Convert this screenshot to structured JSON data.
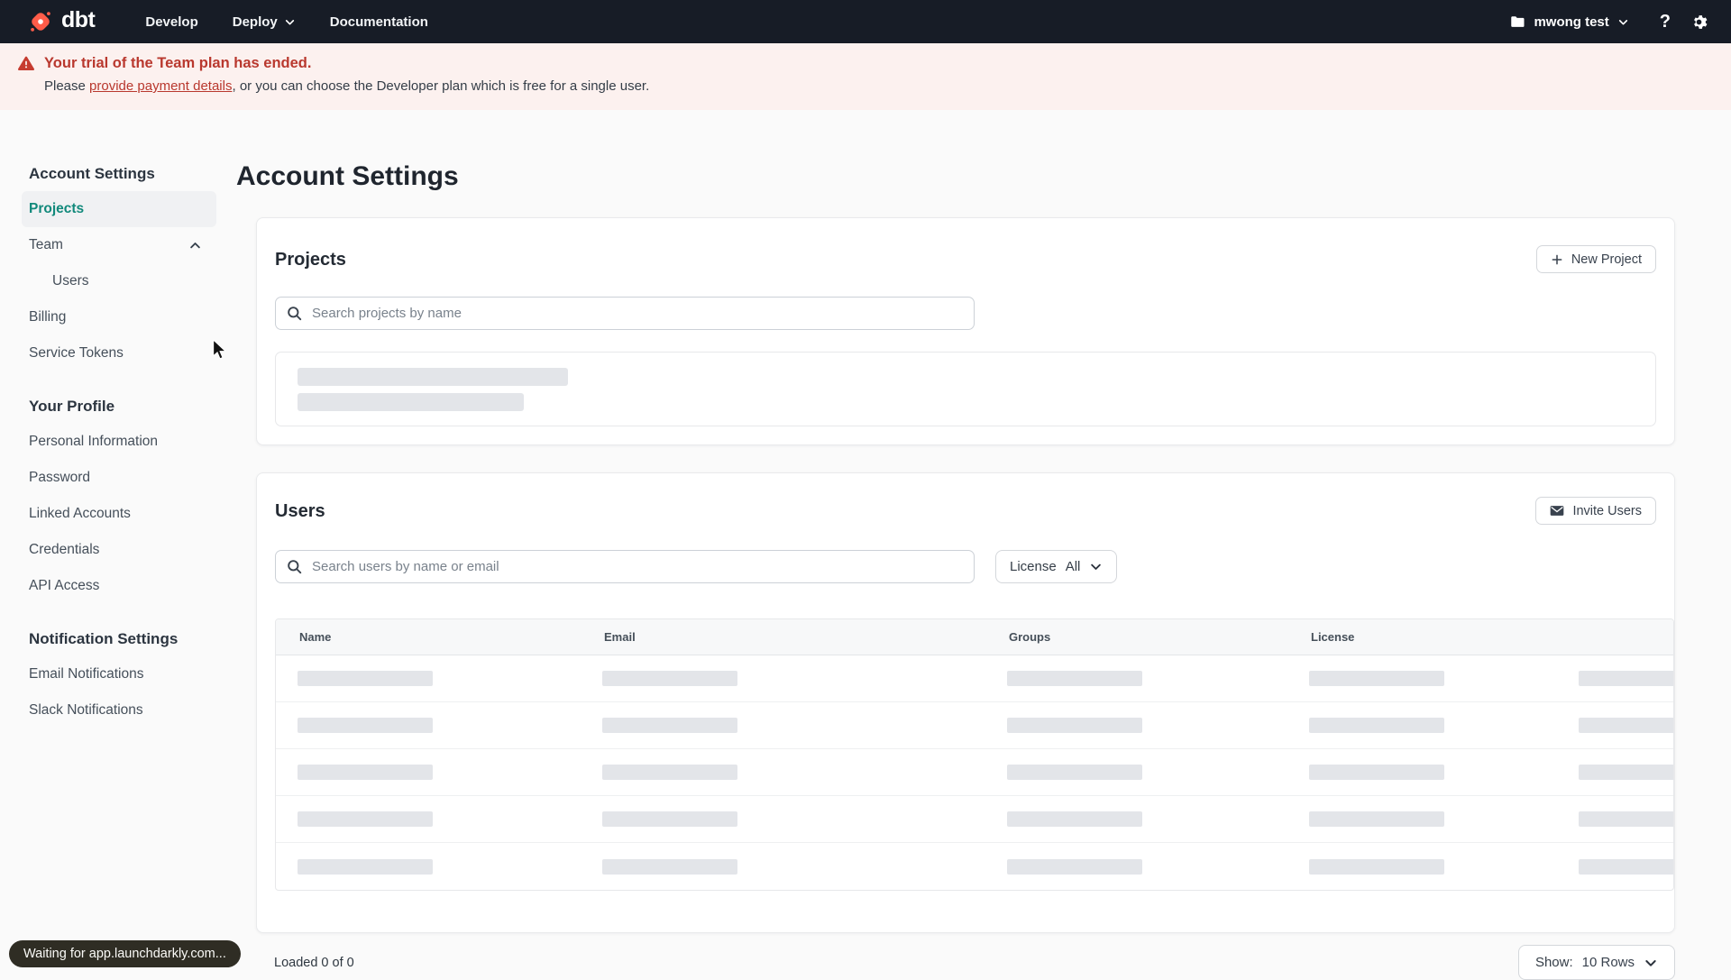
{
  "colors": {
    "accent_orange": "#ff5c49",
    "nav_bg": "#171c26",
    "banner_bg": "#fcf1ef",
    "banner_red": "#b9382e",
    "active_teal": "#11897b",
    "skeleton_gray": "#e3e5e9"
  },
  "navbar": {
    "logo_text": "dbt",
    "menu": {
      "develop": "Develop",
      "deploy": "Deploy",
      "documentation": "Documentation"
    },
    "account_name": "mwong test",
    "help_label": "?"
  },
  "banner": {
    "title": "Your trial of the Team plan has ended.",
    "message_prefix": "Please ",
    "link_text": "provide payment details",
    "message_suffix": ", or you can choose the Developer plan which is free for a single user."
  },
  "sidebar": {
    "account_section": {
      "heading": "Account Settings",
      "projects": "Projects",
      "team": "Team",
      "users": "Users",
      "billing": "Billing",
      "service_tokens": "Service Tokens"
    },
    "profile_section": {
      "heading": "Your Profile",
      "items": [
        "Personal Information",
        "Password",
        "Linked Accounts",
        "Credentials",
        "API Access"
      ]
    },
    "notification_section": {
      "heading": "Notification Settings",
      "items": [
        "Email Notifications",
        "Slack Notifications"
      ]
    }
  },
  "main": {
    "page_title": "Account Settings",
    "projects_card": {
      "title": "Projects",
      "new_project_button": "New Project",
      "search_placeholder": "Search projects by name"
    },
    "users_card": {
      "title": "Users",
      "invite_button": "Invite Users",
      "search_placeholder": "Search users by name or email",
      "license_filter": {
        "label": "License",
        "value": "All"
      },
      "table": {
        "columns": [
          "Name",
          "Email",
          "Groups",
          "License"
        ],
        "skeleton_row_count": 5
      },
      "footer": {
        "loaded_text": "Loaded 0 of 0",
        "show_label": "Show:",
        "show_value": "10 Rows"
      }
    }
  },
  "status_bubble": {
    "text": "Waiting for app.launchdarkly.com..."
  }
}
